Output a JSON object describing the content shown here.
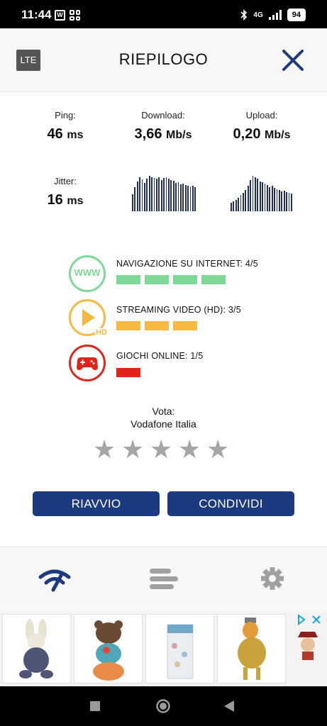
{
  "status_bar": {
    "time": "11:44",
    "network": "4G",
    "battery": "94"
  },
  "header": {
    "network_badge": "LTE",
    "title": "RIEPILOGO",
    "close_icon": "close-icon"
  },
  "metrics": {
    "ping": {
      "label": "Ping:",
      "value": "46",
      "unit": "ms"
    },
    "download": {
      "label": "Download:",
      "value": "3,66",
      "unit": "Mb/s"
    },
    "upload": {
      "label": "Upload:",
      "value": "0,20",
      "unit": "Mb/s"
    },
    "jitter": {
      "label": "Jitter:",
      "value": "16",
      "unit": "ms"
    }
  },
  "quality": [
    {
      "label": "NAVIGAZIONE SU INTERNET: 4/5",
      "score": 4,
      "max": 5,
      "color": "#7ed897",
      "icon": "www-icon",
      "icon_text": "WWW"
    },
    {
      "label": "STREAMING VIDEO (HD): 3/5",
      "score": 3,
      "max": 5,
      "color": "#f5b941",
      "icon": "play-hd-icon",
      "icon_text": "HD"
    },
    {
      "label": "GIOCHI ONLINE: 1/5",
      "score": 1,
      "max": 5,
      "color": "#e2231a",
      "icon": "gamepad-icon"
    }
  ],
  "vote": {
    "label": "Vota:",
    "operator": "Vodafone Italia",
    "stars_total": 5
  },
  "buttons": {
    "restart": "RIAVVIO",
    "share": "CONDIVIDI"
  },
  "tabs": [
    {
      "name": "speedtest-tab",
      "icon": "speedometer-icon",
      "color": "#1b3a7f"
    },
    {
      "name": "history-tab",
      "icon": "list-icon",
      "color": "#a0a0a0"
    },
    {
      "name": "settings-tab",
      "icon": "gear-icon",
      "color": "#a0a0a0"
    }
  ],
  "ad": {
    "items": [
      "plush-rabbit-product",
      "bear-toy-product",
      "baby-blanket-product",
      "fox-plush-product"
    ]
  },
  "colors": {
    "accent": "#1b3a7f",
    "graph": "#1f2e5a"
  }
}
